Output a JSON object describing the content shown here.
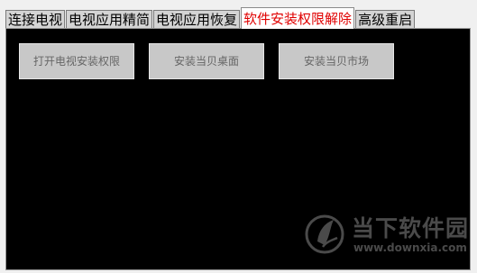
{
  "tabs": [
    {
      "label": "连接电视"
    },
    {
      "label": "电视应用精简"
    },
    {
      "label": "电视应用恢复"
    },
    {
      "label": "软件安装权限解除"
    },
    {
      "label": "高级重启"
    }
  ],
  "active_tab_color": "#e00000",
  "buttons": [
    {
      "label": "打开电视安装权限"
    },
    {
      "label": "安装当贝桌面"
    },
    {
      "label": "安装当贝市场"
    }
  ],
  "watermark": {
    "name": "当下软件园",
    "url": "www.downxia.com",
    "icon": "downxia-logo"
  }
}
